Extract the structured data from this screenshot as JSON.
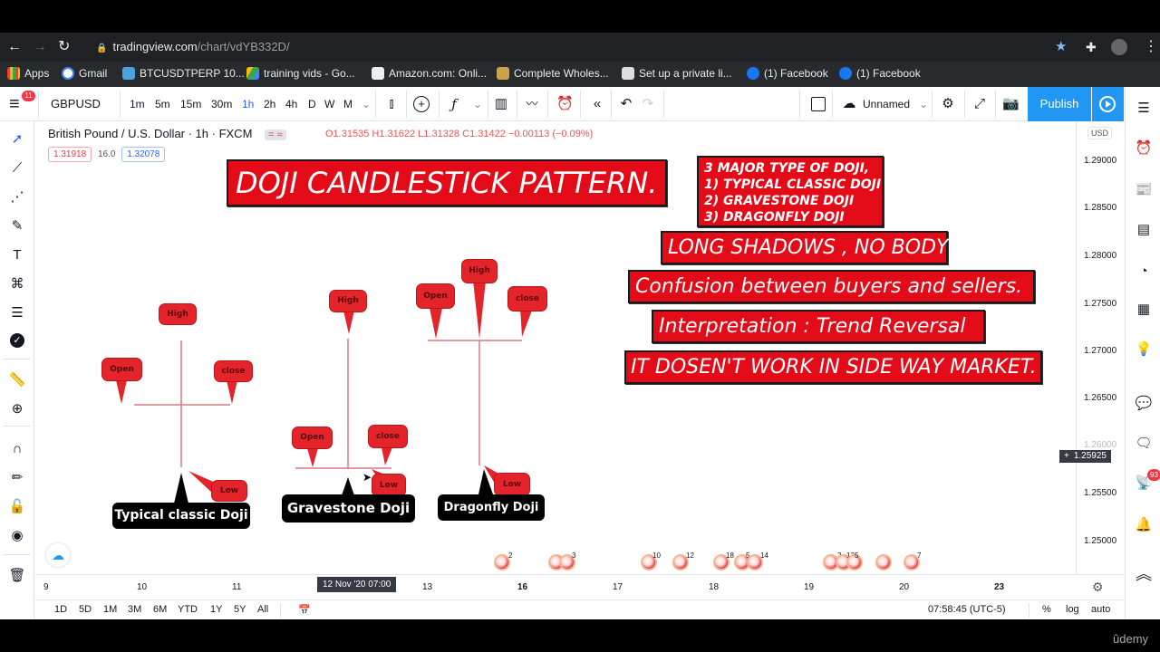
{
  "browser": {
    "url_host": "tradingview.com",
    "url_path": "/chart/vdYB332D/",
    "bookmarks": [
      {
        "label": "Apps",
        "icon": "apps-grid-icon"
      },
      {
        "label": "Gmail",
        "icon": "google-icon"
      },
      {
        "label": "BTCUSDTPERP 10...",
        "icon": "tradingview-cloud-icon"
      },
      {
        "label": "training vids - Go...",
        "icon": "google-drive-icon"
      },
      {
        "label": "Amazon.com: Onli...",
        "icon": "amazon-icon"
      },
      {
        "label": "Complete Wholes...",
        "icon": "crown-icon"
      },
      {
        "label": "Set up a private li...",
        "icon": "crown-box-icon"
      },
      {
        "label": "(1) Facebook",
        "icon": "facebook-icon"
      },
      {
        "label": "(1) Facebook",
        "icon": "facebook-icon"
      }
    ]
  },
  "topbar": {
    "menu_badge": "11",
    "symbol": "GBPUSD",
    "intervals": [
      "1m",
      "5m",
      "15m",
      "30m",
      "1h",
      "2h",
      "4h",
      "D",
      "W",
      "M"
    ],
    "active_interval": "1h",
    "layout_name": "Unnamed",
    "publish_label": "Publish"
  },
  "legend": {
    "title": "British Pound / U.S. Dollar · 1h · FXCM",
    "open": "O1.31535",
    "high": "H1.31622",
    "low": "L1.31328",
    "close": "C1.31422",
    "change": "−0.00113 (−0.09%)",
    "bid": "1.31918",
    "spread": "16.0",
    "ask": "1.32078"
  },
  "annotations": {
    "title": "DOJI CANDLESTICK PATTERN.",
    "types_box": [
      "3 MAJOR TYPE OF DOJI,",
      "1) TYPICAL CLASSIC DOJI",
      "2) GRAVESTONE DOJI",
      "3) DRAGONFLY DOJI"
    ],
    "points": [
      "LONG SHADOWS , NO BODY",
      "Confusion between buyers and sellers.",
      "Interpretation : Trend Reversal",
      "IT DOSEN'T WORK IN SIDE WAY MARKET."
    ],
    "dojis": [
      {
        "name": "Typical classic Doji",
        "labels": {
          "high": "High",
          "open": "Open",
          "close": "close",
          "low": "Low"
        }
      },
      {
        "name": "Gravestone Doji",
        "labels": {
          "high": "High",
          "open": "Open",
          "close": "close",
          "low": "Low"
        }
      },
      {
        "name": "Dragonfly Doji",
        "labels": {
          "high": "High",
          "open": "Open",
          "close": "close",
          "low": "Low"
        }
      }
    ]
  },
  "price_axis": {
    "currency": "USD",
    "ticks": [
      "1.29000",
      "1.28500",
      "1.28000",
      "1.27500",
      "1.27000",
      "1.26500",
      "1.26000",
      "1.25500",
      "1.25000"
    ],
    "cursor_price": "1.25925"
  },
  "time_axis": {
    "ticks": [
      "9",
      "10",
      "11",
      "13",
      "16",
      "17",
      "18",
      "19",
      "20",
      "23"
    ],
    "cursor_time": "12 Nov '20   07:00"
  },
  "events": [
    {
      "count": "2"
    },
    {
      "count": "3"
    },
    {
      "count": "10"
    },
    {
      "count": "12"
    },
    {
      "count": "18"
    },
    {
      "count": "5"
    },
    {
      "count": "14"
    },
    {
      "count": "2"
    },
    {
      "count": "13"
    },
    {
      "count": "5"
    },
    {
      "count": ""
    },
    {
      "count": "7"
    }
  ],
  "bottombar": {
    "ranges": [
      "1D",
      "5D",
      "1M",
      "3M",
      "6M",
      "YTD",
      "1Y",
      "5Y",
      "All"
    ],
    "clock": "07:58:45 (UTC-5)",
    "percent": "%",
    "log": "log",
    "auto": "auto"
  },
  "right_badge": "93",
  "watermark": "ûdemy",
  "colors": {
    "accent": "#2196f3",
    "annotation_red": "#e30b17",
    "down": "#ef5350"
  }
}
